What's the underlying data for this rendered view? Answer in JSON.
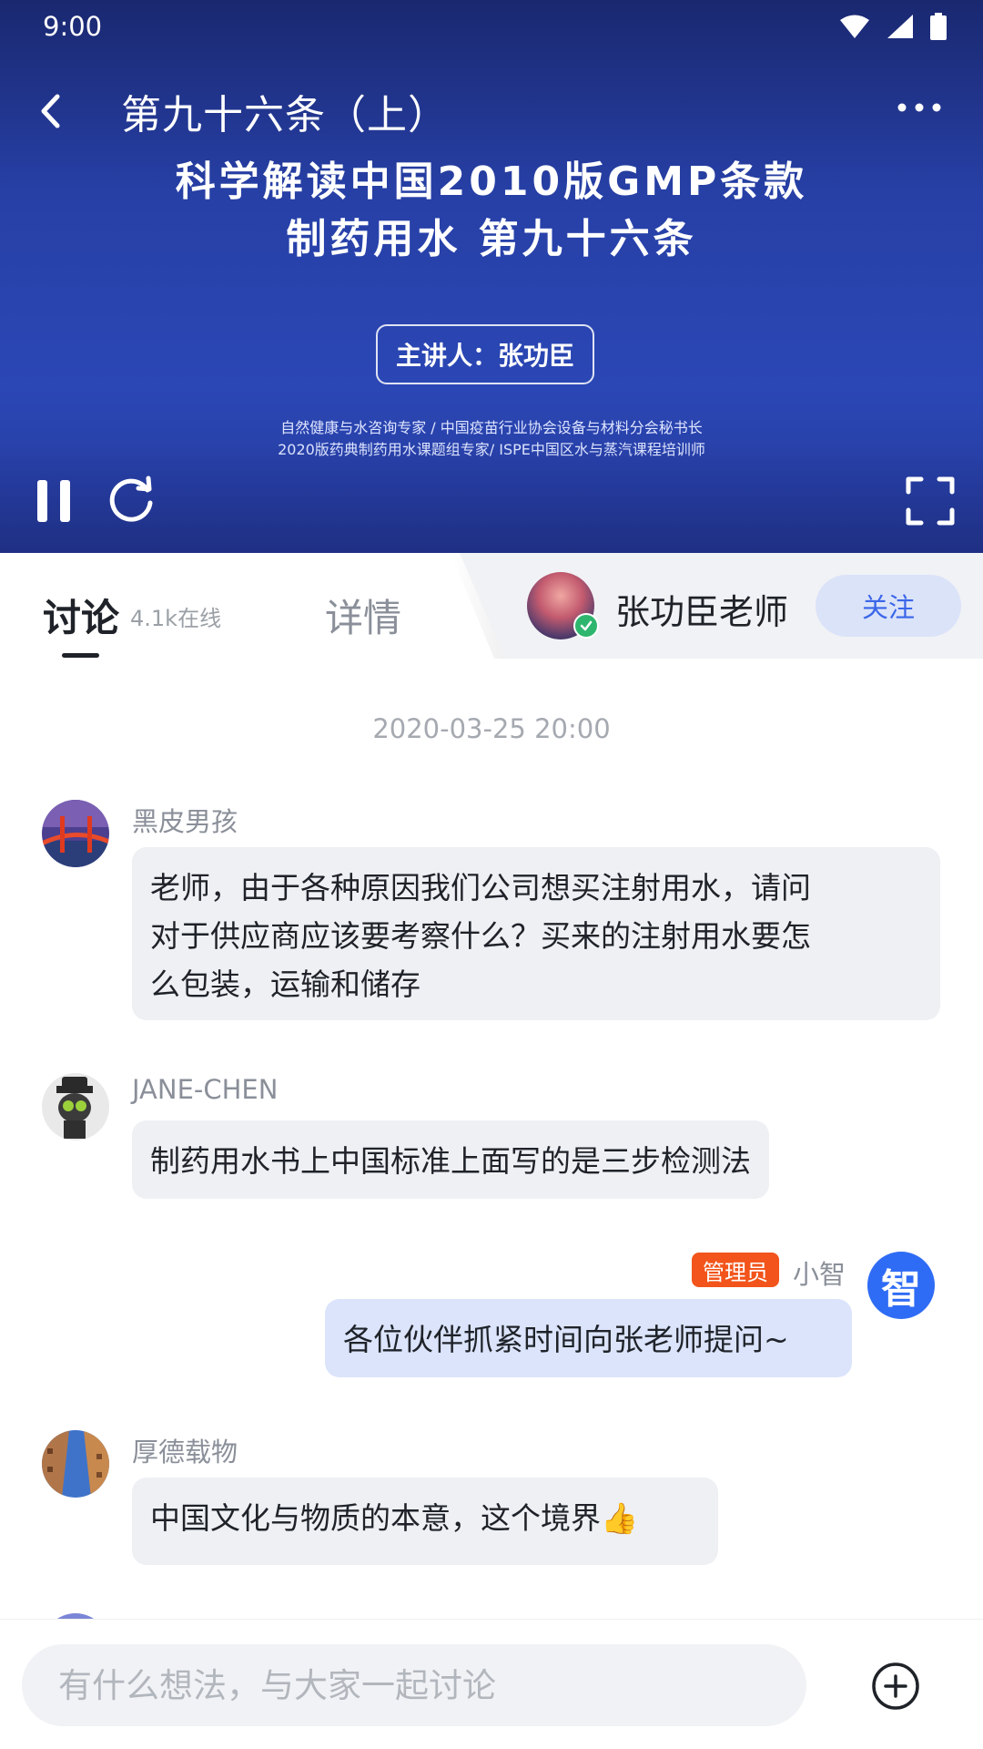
{
  "status_bar": {
    "time": "9:00"
  },
  "video": {
    "title": "第九十六条（上）",
    "slide_line1": "科学解读中国2010版GMP条款",
    "slide_line2": "制药用水 第九十六条",
    "speaker": "主讲人：张功臣",
    "desc_line1": "自然健康与水咨询专家 / 中国疫苗行业协会设备与材料分会秘书长",
    "desc_line2": "2020版药典制药用水课题组专家/ ISPE中国区水与蒸汽课程培训师"
  },
  "tabs": {
    "discussion": "讨论",
    "online": "4.1k在线",
    "detail": "详情"
  },
  "teacher": {
    "name": "张功臣老师",
    "follow": "关注"
  },
  "chat": {
    "timestamp": "2020-03-25 20:00",
    "messages": [
      {
        "user": "黑皮男孩",
        "line1": "老师，由于各种原因我们公司想买注射用水，请问",
        "line2": "对于供应商应该要考察什么？买来的注射用水要怎",
        "line3": "么包装，运输和储存"
      },
      {
        "user": "JANE-CHEN",
        "text": "制药用水书上中国标准上面写的是三步检测法"
      },
      {
        "user": "小智",
        "badge": "管理员",
        "avatar_char": "智",
        "text": "各位伙伴抓紧时间向张老师提问~"
      },
      {
        "user": "厚德载物",
        "text": "中国文化与物质的本意，这个境界👍"
      }
    ]
  },
  "input": {
    "placeholder": "有什么想法，与大家一起讨论"
  },
  "colors": {
    "accent": "#3a66e8",
    "admin_badge": "#f2541b",
    "verified": "#2fb66e"
  }
}
